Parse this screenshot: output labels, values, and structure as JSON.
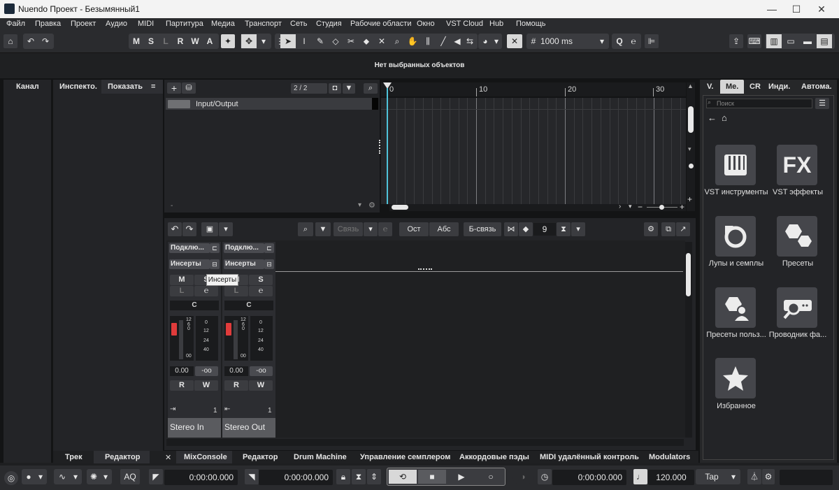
{
  "window": {
    "title": "Nuendo Проект - Безымянный1"
  },
  "menu": [
    "Файл",
    "Правка",
    "Проект",
    "Аудио",
    "MIDI",
    "Партитура",
    "Медиа",
    "Транспорт",
    "Сеть",
    "Студия",
    "Рабочие области",
    "Окно",
    "VST Cloud",
    "Hub",
    "Помощь"
  ],
  "toolbar": {
    "msl": [
      "M",
      "S",
      "L",
      "R",
      "W",
      "A"
    ],
    "quantize_value": "1000 ms"
  },
  "info_line": {
    "text": "Нет выбранных объектов"
  },
  "left_zone": {
    "channel_tab": "Канал",
    "inspector_tab": "Инспекто.",
    "show_tab": "Показать",
    "show_menu": "=",
    "bottom_tabs": [
      "Трек",
      "Редактор"
    ]
  },
  "track_list": {
    "counter": "2 / 2",
    "tracks": [
      {
        "name": "Input/Output"
      }
    ],
    "footer_dash": "-"
  },
  "ruler": {
    "marks": [
      "0",
      "10",
      "20",
      "30"
    ]
  },
  "mixer_toolbar": {
    "link_label": "Связь",
    "ost_label": "Ост",
    "abc_label": "Абс",
    "blink_label": "Б-связь",
    "visible_count": "9"
  },
  "channels": [
    {
      "routing": "Подклю...",
      "inserts": "Инсерты",
      "mute": "M",
      "solo": "S",
      "listen": "L",
      "pan": "C",
      "level": "0.00",
      "peak": "-oo",
      "read": "R",
      "write": "W",
      "io_number": "1",
      "name": "Stereo In"
    },
    {
      "routing": "Подклю...",
      "inserts": "Инсерты",
      "mute": "M",
      "solo": "S",
      "listen": "L",
      "pan": "C",
      "level": "0.00",
      "peak": "-oo",
      "read": "R",
      "write": "W",
      "io_number": "1",
      "name": "Stereo Out"
    }
  ],
  "meter_scale_left": [
    "12",
    "6",
    "0",
    "00"
  ],
  "meter_scale_right": [
    "0",
    "12",
    "24",
    "40"
  ],
  "tooltip": {
    "text": "Инсерты"
  },
  "lower_tabs": [
    "MixConsole",
    "Редактор",
    "Drum Machine",
    "Управление семплером",
    "Аккордовые пэды",
    "MIDI удалённый контроль",
    "Modulators"
  ],
  "lower_close": "✕",
  "right_zone": {
    "tabs": [
      "V.",
      "Ме.",
      "CR",
      "Инди.",
      "Автома."
    ],
    "search_placeholder": "Поиск",
    "tiles": [
      {
        "label": "VST инструменты",
        "icon": "piano-keys-icon"
      },
      {
        "label": "VST эффекты",
        "icon": "fx-icon",
        "glyph": "FX"
      },
      {
        "label": "Лупы и семплы",
        "icon": "loop-icon"
      },
      {
        "label": "Пресеты",
        "icon": "hexagons-icon"
      },
      {
        "label": "Пресеты польз...",
        "icon": "user-presets-icon"
      },
      {
        "label": "Проводник фа...",
        "icon": "file-browser-icon"
      },
      {
        "label": "Избранное",
        "icon": "star-icon"
      }
    ]
  },
  "transport": {
    "aq_label": "AQ",
    "left_locator": "0:00:00.000",
    "right_locator": "0:00:00.000",
    "primary_time": "0:00:00.000",
    "tempo": "120.000",
    "tap_label": "Tap"
  },
  "colors": {
    "playhead": "#4fc3d9",
    "fader_red": "#e03b3b",
    "bg": "#1e1f21"
  }
}
